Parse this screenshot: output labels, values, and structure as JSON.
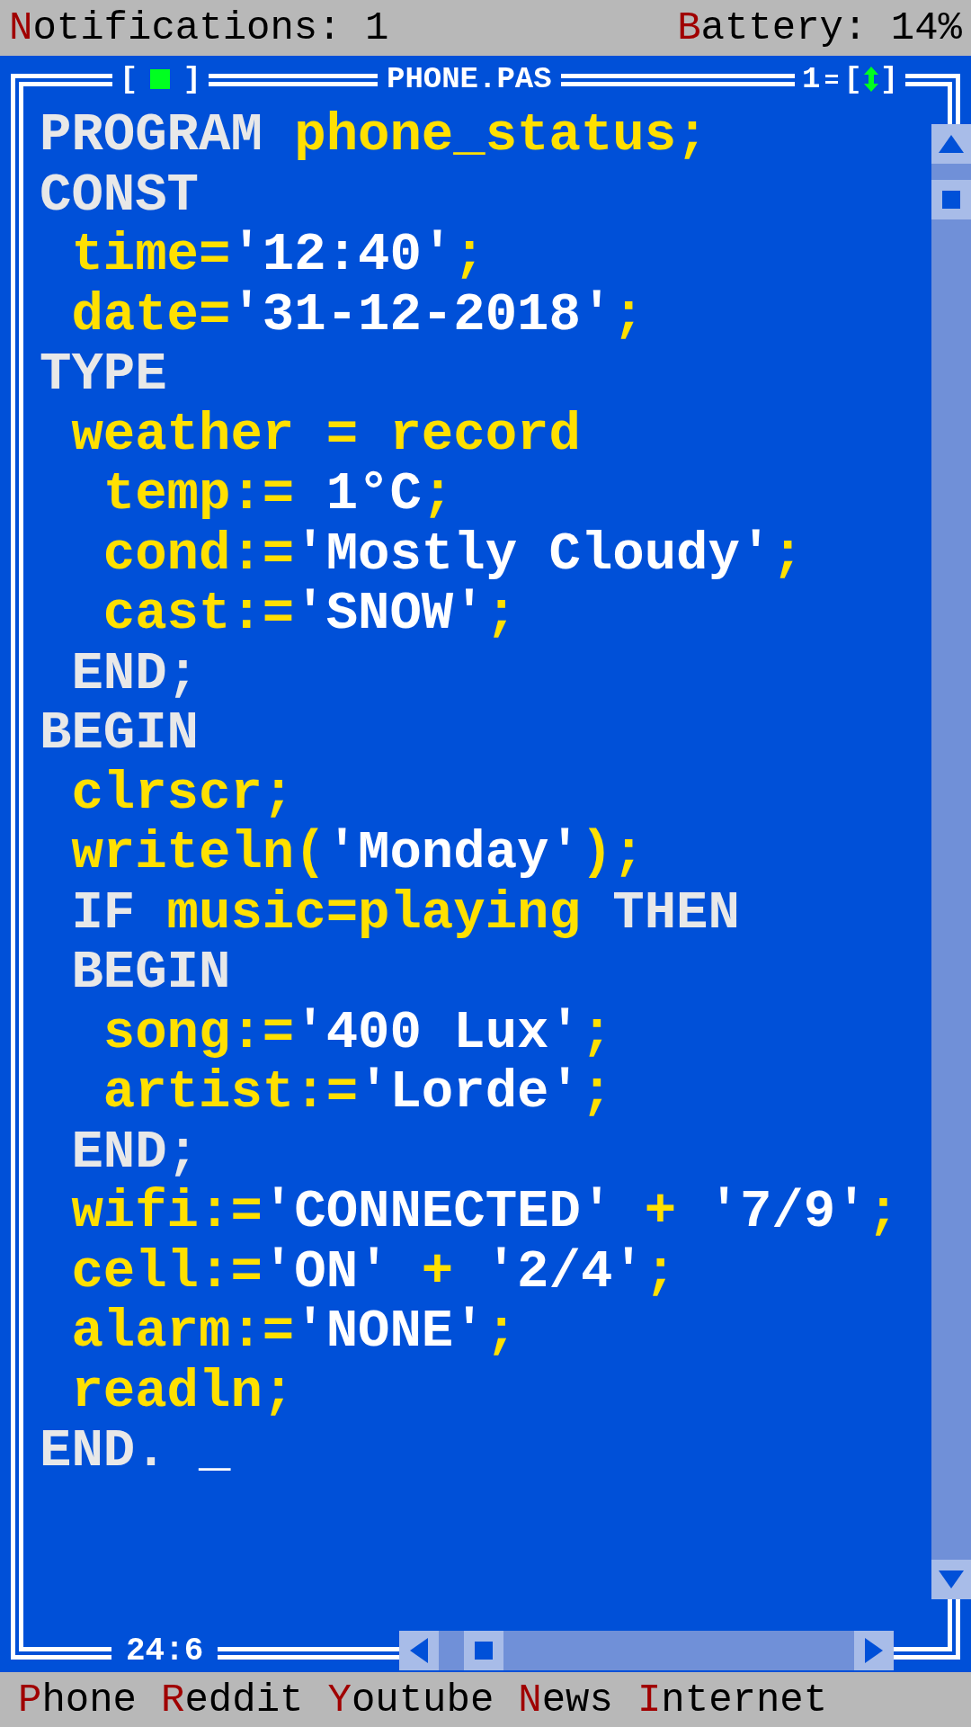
{
  "status_bar": {
    "left": {
      "hotkey": "N",
      "rest": "otifications: 1"
    },
    "right": {
      "hotkey": "B",
      "rest": "attery: 14%"
    }
  },
  "window": {
    "close": {
      "open": "[",
      "close": "]"
    },
    "title": "PHONE.PAS",
    "number": "1",
    "zoom": {
      "open": "[",
      "close": "]"
    },
    "position": "24:6"
  },
  "code": [
    [
      {
        "t": "PROGRAM",
        "kind": "kw"
      },
      {
        "t": " phone_status;",
        "kind": "id"
      }
    ],
    [
      {
        "t": "CONST",
        "kind": "kw"
      }
    ],
    [
      {
        "t": " time=",
        "kind": "id"
      },
      {
        "t": "'12:40'",
        "kind": "str"
      },
      {
        "t": ";",
        "kind": "id"
      }
    ],
    [
      {
        "t": " date=",
        "kind": "id"
      },
      {
        "t": "'31-12-2018'",
        "kind": "str"
      },
      {
        "t": ";",
        "kind": "id"
      }
    ],
    [
      {
        "t": "TYPE",
        "kind": "kw"
      }
    ],
    [
      {
        "t": " weather = record",
        "kind": "id"
      }
    ],
    [
      {
        "t": "  temp:= ",
        "kind": "id"
      },
      {
        "t": "1°C",
        "kind": "str"
      },
      {
        "t": ";",
        "kind": "id"
      }
    ],
    [
      {
        "t": "  cond:=",
        "kind": "id"
      },
      {
        "t": "'Mostly Cloudy'",
        "kind": "str"
      },
      {
        "t": ";",
        "kind": "id"
      }
    ],
    [
      {
        "t": "  cast:=",
        "kind": "id"
      },
      {
        "t": "'SNOW'",
        "kind": "str"
      },
      {
        "t": ";",
        "kind": "id"
      }
    ],
    [
      {
        "t": " END;",
        "kind": "kw"
      }
    ],
    [
      {
        "t": "BEGIN",
        "kind": "kw"
      }
    ],
    [
      {
        "t": " clrscr;",
        "kind": "id"
      }
    ],
    [
      {
        "t": " writeln(",
        "kind": "id"
      },
      {
        "t": "'Monday'",
        "kind": "str"
      },
      {
        "t": ");",
        "kind": "id"
      }
    ],
    [
      {
        "t": " IF",
        "kind": "kw"
      },
      {
        "t": " music=playing",
        "kind": "id"
      },
      {
        "t": " THEN",
        "kind": "kw"
      }
    ],
    [
      {
        "t": " BEGIN",
        "kind": "kw"
      }
    ],
    [
      {
        "t": "  song:=",
        "kind": "id"
      },
      {
        "t": "'400 Lux'",
        "kind": "str"
      },
      {
        "t": ";",
        "kind": "id"
      }
    ],
    [
      {
        "t": "  artist:=",
        "kind": "id"
      },
      {
        "t": "'Lorde'",
        "kind": "str"
      },
      {
        "t": ";",
        "kind": "id"
      }
    ],
    [
      {
        "t": " END;",
        "kind": "kw"
      }
    ],
    [
      {
        "t": " wifi:=",
        "kind": "id"
      },
      {
        "t": "'CONNECTED'",
        "kind": "str"
      },
      {
        "t": " + ",
        "kind": "id"
      },
      {
        "t": "'7/9'",
        "kind": "str"
      },
      {
        "t": ";",
        "kind": "id"
      }
    ],
    [
      {
        "t": " cell:=",
        "kind": "id"
      },
      {
        "t": "'ON'",
        "kind": "str"
      },
      {
        "t": " + ",
        "kind": "id"
      },
      {
        "t": "'2/4'",
        "kind": "str"
      },
      {
        "t": ";",
        "kind": "id"
      }
    ],
    [
      {
        "t": " alarm:=",
        "kind": "id"
      },
      {
        "t": "'NONE'",
        "kind": "str"
      },
      {
        "t": ";",
        "kind": "id"
      }
    ],
    [
      {
        "t": " readln;",
        "kind": "id"
      }
    ],
    [
      {
        "t": "END. ",
        "kind": "kw"
      },
      {
        "t": "_",
        "kind": "cur"
      }
    ]
  ],
  "menu": [
    {
      "hotkey": "P",
      "rest": "hone"
    },
    {
      "hotkey": "R",
      "rest": "eddit"
    },
    {
      "hotkey": "Y",
      "rest": "outube"
    },
    {
      "hotkey": "N",
      "rest": "ews"
    },
    {
      "hotkey": "I",
      "rest": "nternet"
    }
  ]
}
